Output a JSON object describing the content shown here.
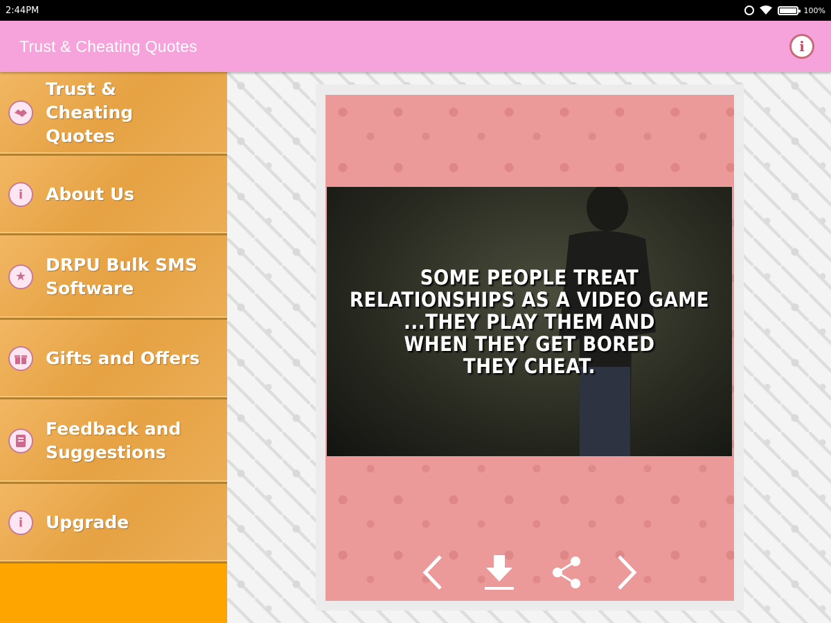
{
  "status_bar": {
    "time": "2:44PM",
    "battery": "100%"
  },
  "action_bar": {
    "title": "Trust & Cheating Quotes",
    "info_icon": "info-icon"
  },
  "menu": {
    "items": [
      {
        "label": "Trust & Cheating Quotes",
        "icon": "handshake-icon"
      },
      {
        "label": "About Us",
        "icon": "info-icon"
      },
      {
        "label": "DRPU Bulk SMS Software",
        "icon": "star-icon"
      },
      {
        "label": "Gifts and Offers",
        "icon": "gift-icon"
      },
      {
        "label": "Feedback and Suggestions",
        "icon": "feedback-icon"
      },
      {
        "label": "Upgrade",
        "icon": "info-icon"
      }
    ]
  },
  "quote": {
    "text": "SOME PEOPLE TREAT\nRELATIONSHIPS AS A VIDEO GAME\n...THEY PLAY THEM AND\nWHEN THEY GET BORED\nTHEY CHEAT."
  },
  "controls": {
    "prev": "chevron-left-icon",
    "download": "download-icon",
    "share": "share-icon",
    "next": "chevron-right-icon"
  },
  "colors": {
    "action_bar": "#f6a3dc",
    "menu_bg": "#ffa500",
    "menu_item": "#e6a243",
    "card": "#eb9999"
  }
}
